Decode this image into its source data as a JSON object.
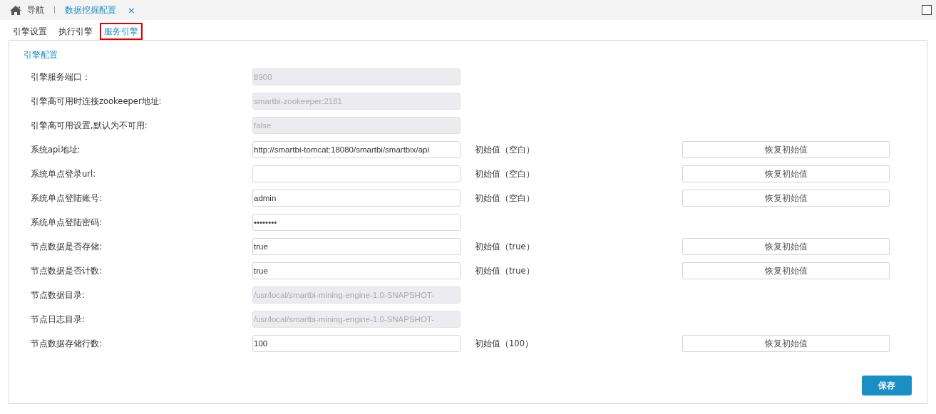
{
  "nav": {
    "home": "导航",
    "tab": "数据挖掘配置",
    "close": "×"
  },
  "tabs": [
    {
      "label": "引擎设置",
      "selected": false
    },
    {
      "label": "执行引擎",
      "selected": false
    },
    {
      "label": "服务引擎",
      "selected": true
    }
  ],
  "section_title": "引擎配置",
  "fields": [
    {
      "label": "引擎服务端口：",
      "value": "8900",
      "disabled": true
    },
    {
      "label": "引擎高可用时连接zookeeper地址:",
      "value": "smartbi-zookeeper:2181",
      "disabled": true
    },
    {
      "label": "引擎高可用设置,默认为不可用:",
      "value": "false",
      "disabled": true
    },
    {
      "label": "系统api地址:",
      "value": "http://smartbi-tomcat:18080/smartbi/smartbix/api",
      "disabled": false,
      "initial": "初始值（空白）",
      "reset": "恢复初始值"
    },
    {
      "label": "系统单点登录url:",
      "disabled": false,
      "initial": "初始值（空白）",
      "reset": "恢复初始值"
    },
    {
      "label": "系统单点登陆账号:",
      "value": "admin",
      "disabled": false,
      "initial": "初始值（空白）",
      "reset": "恢复初始值"
    },
    {
      "label": "系统单点登陆密码:",
      "value": "••••••••",
      "disabled": false
    },
    {
      "label": "节点数据是否存储:",
      "value": "true",
      "disabled": false,
      "initial": "初始值（true）",
      "reset": "恢复初始值"
    },
    {
      "label": "节点数据是否计数:",
      "value": "true",
      "disabled": false,
      "initial": "初始值（true）",
      "reset": "恢复初始值"
    },
    {
      "label": "节点数据目录:",
      "value": "/usr/local/smartbi-mining-engine-1.0-SNAPSHOT-",
      "disabled": true
    },
    {
      "label": "节点日志目录:",
      "value": "/usr/local/smartbi-mining-engine-1.0-SNAPSHOT-",
      "disabled": true
    },
    {
      "label": "节点数据存储行数:",
      "value": "100",
      "disabled": false,
      "initial": "初始值（100）",
      "reset": "恢复初始值"
    }
  ],
  "save": "保存"
}
